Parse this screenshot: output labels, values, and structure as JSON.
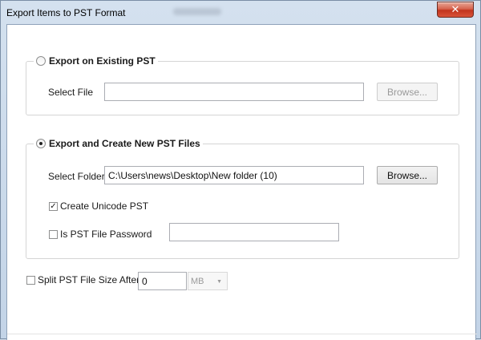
{
  "window": {
    "title": "Export Items to PST Format",
    "close_glyph": "✕"
  },
  "existing_pst": {
    "legend": "Export on Existing PST",
    "selected": false,
    "select_file_label": "Select File",
    "file_value": "",
    "browse_label": "Browse...",
    "browse_enabled": false
  },
  "new_pst": {
    "legend": "Export and Create New  PST Files",
    "selected": true,
    "select_folder_label": "Select Folder",
    "folder_value": "C:\\Users\\news\\Desktop\\New folder (10)",
    "browse_label": "Browse...",
    "unicode_label": "Create Unicode PST",
    "unicode_checked": true,
    "password_label": "Is PST File Password",
    "password_checked": false,
    "password_value": ""
  },
  "split": {
    "label": "Split PST File Size After",
    "checked": false,
    "size_value": "0",
    "unit": "MB"
  },
  "colors": {
    "title_bg": "#c9d9ea",
    "close_red": "#c1341e",
    "client_bg": "#ffffff"
  }
}
